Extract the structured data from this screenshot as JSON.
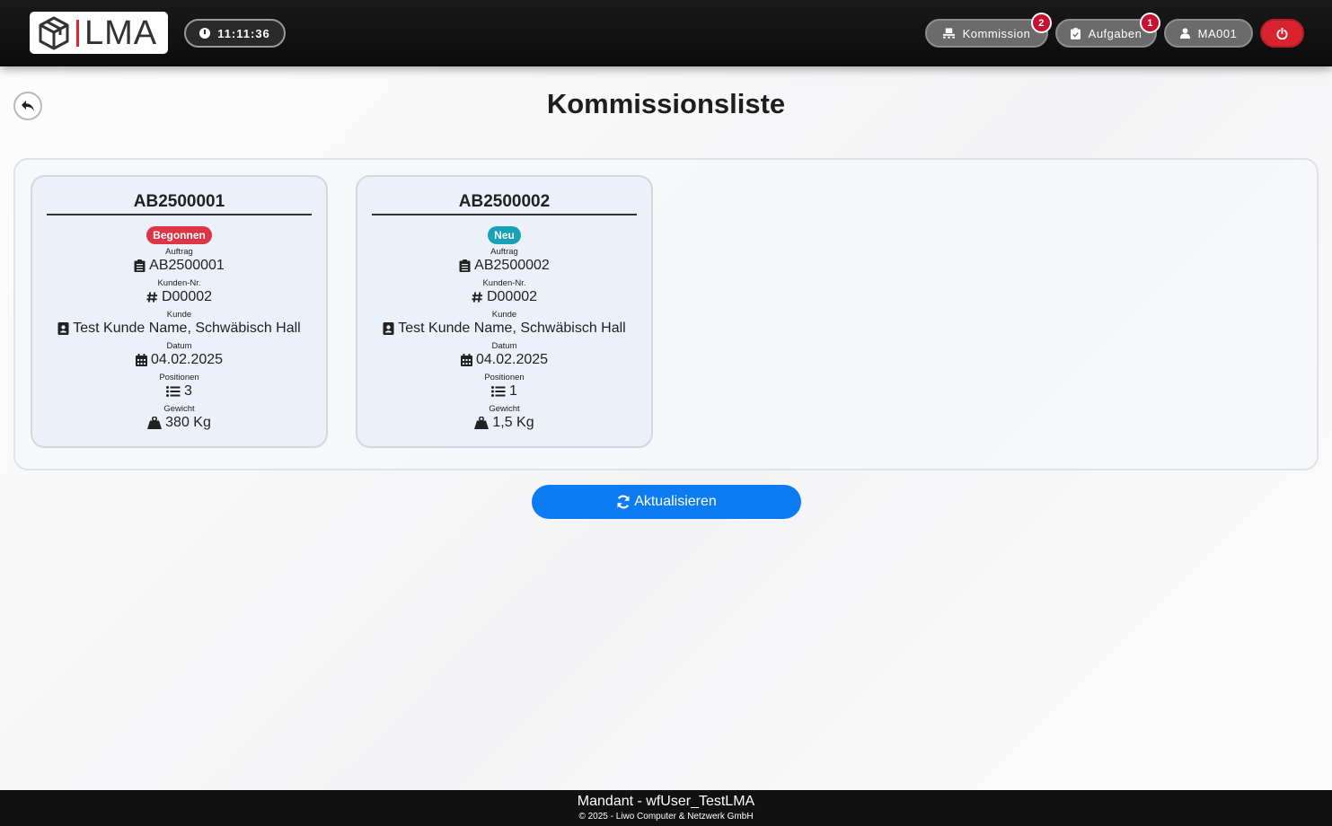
{
  "header": {
    "brand": "LMA",
    "clock": "11:11:36",
    "kommission": {
      "label": "Kommission",
      "badge": "2"
    },
    "aufgaben": {
      "label": "Aufgaben",
      "badge": "1"
    },
    "user": {
      "label": "MA001"
    },
    "colors": {
      "power": "#d9232f",
      "badge": "#c8102e"
    }
  },
  "page": {
    "title": "Kommissionsliste",
    "refresh_label": "Aktualisieren"
  },
  "labels": {
    "auftrag": "Auftrag",
    "kunden_nr": "Kunden-Nr.",
    "kunde": "Kunde",
    "datum": "Datum",
    "positionen": "Positionen",
    "gewicht": "Gewicht"
  },
  "cards": [
    {
      "title": "AB2500001",
      "status": "Begonnen",
      "status_color": "#dc3545",
      "auftrag": "AB2500001",
      "kunden_nr": "D00002",
      "kunde": "Test Kunde Name, Schwäbisch Hall",
      "datum": "04.02.2025",
      "positionen": "3",
      "gewicht": "380 Kg"
    },
    {
      "title": "AB2500002",
      "status": "Neu",
      "status_color": "#17a2b8",
      "auftrag": "AB2500002",
      "kunden_nr": "D00002",
      "kunde": "Test Kunde Name, Schwäbisch Hall",
      "datum": "04.02.2025",
      "positionen": "1",
      "gewicht": "1,5 Kg"
    }
  ],
  "footer": {
    "line1": "Mandant - wfUser_TestLMA",
    "line2": "© 2025 - Liwo Computer & Netzwerk GmbH"
  }
}
